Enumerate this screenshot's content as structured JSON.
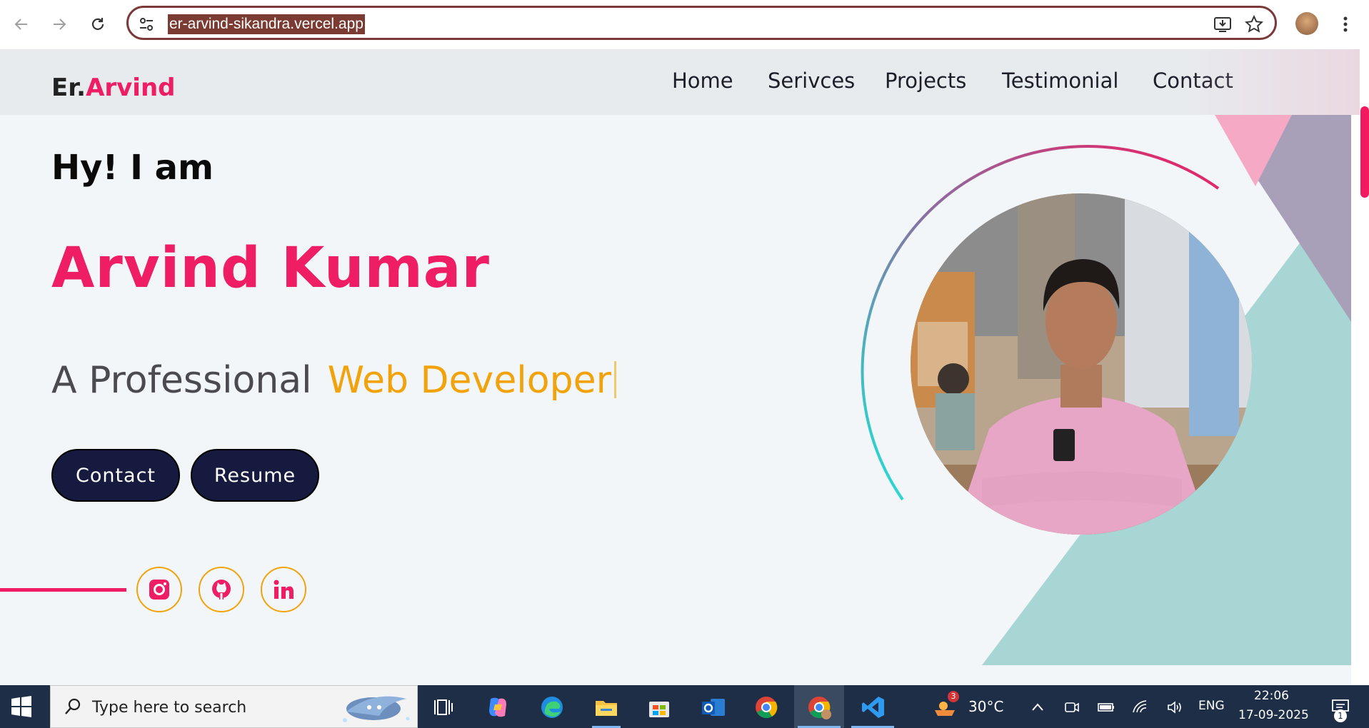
{
  "browser": {
    "url": "er-arvind-sikandra.vercel.app"
  },
  "site": {
    "logo_prefix": "Er.",
    "logo_accent": "Arvind",
    "nav": [
      "Home",
      "Serivces",
      "Projects",
      "Testimonial",
      "Contact"
    ],
    "greeting": "Hy! I am",
    "name": "Arvind Kumar",
    "role_prefix": "A Professional",
    "role_highlight": "Web Developer",
    "buttons": {
      "contact": "Contact",
      "resume": "Resume"
    },
    "social": [
      "instagram-icon",
      "github-icon",
      "linkedin-icon"
    ],
    "colors": {
      "accent": "#ef1d63",
      "highlight": "#f2a30c",
      "button": "#151a3e"
    }
  },
  "taskbar": {
    "search_placeholder": "Type here to search",
    "weather_badge": "3",
    "temperature": "30°C",
    "language": "ENG",
    "time": "22:06",
    "date": "17-09-2025",
    "notifications": "1"
  }
}
